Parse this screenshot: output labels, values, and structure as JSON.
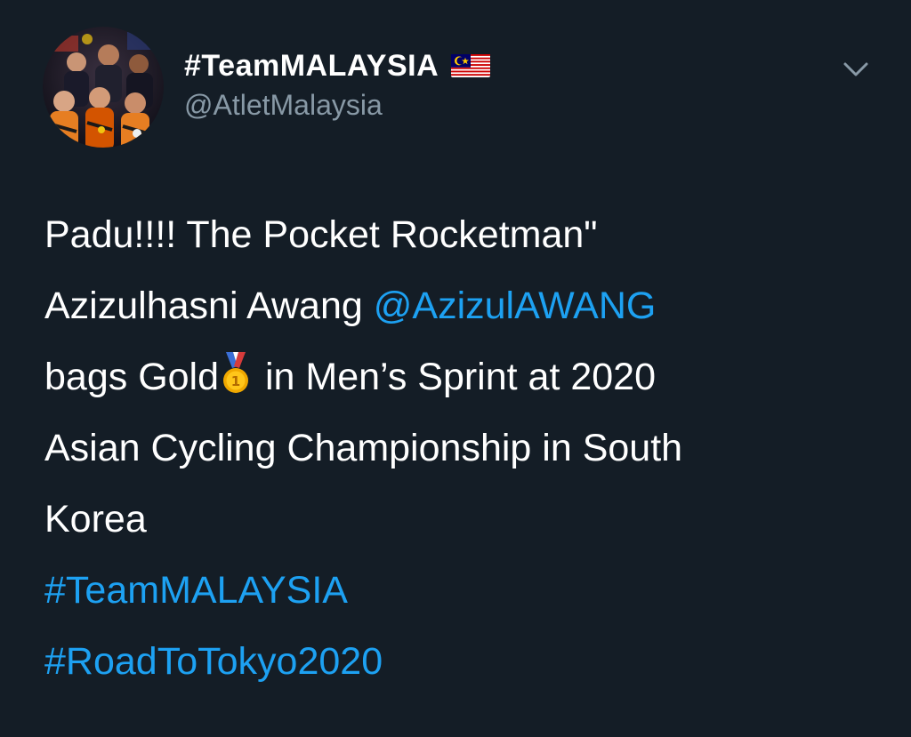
{
  "account": {
    "display_name": "#TeamMALAYSIA",
    "handle": "@AtletMalaysia",
    "flag_icon": "malaysia-flag-icon",
    "avatar": "team-photo-avatar"
  },
  "menu": {
    "icon": "chevron-down-icon"
  },
  "tweet": {
    "line1": "Padu!!!! The Pocket Rocketman\"",
    "line2_text": "Azizulhasni Awang  ",
    "line2_mention": "@AzizulAWANG",
    "line3_before": "bags Gold",
    "line3_after": " in Men’s Sprint at 2020",
    "medal_icon": "gold-medal-icon",
    "line4": "Asian Cycling Championship in South",
    "line5": "Korea",
    "hashtag1": "#TeamMALAYSIA",
    "hashtag2": "#RoadToTokyo2020"
  },
  "colors": {
    "background": "#141d26",
    "text": "#ffffff",
    "secondary_text": "#8899a6",
    "link": "#1da1f2"
  }
}
